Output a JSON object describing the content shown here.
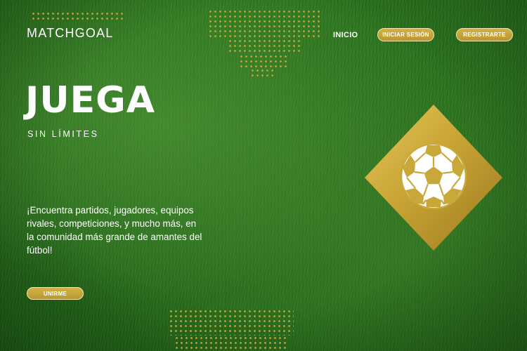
{
  "header": {
    "logo": "MATCHGOAL",
    "nav_home": "INICIO",
    "login_label": "INICIAR SESIÓN",
    "register_label": "REGISTRARTE"
  },
  "hero": {
    "title": "JUEGA",
    "subtitle": "SIN LÍMITES",
    "description": "¡Encuentra partidos, jugadores, equipos rivales, competiciones, y mucho más, en la comunidad más grande de amantes del fútbol!",
    "join_label": "UNIRME"
  },
  "icons": {
    "ball": "soccer-ball-icon"
  },
  "colors": {
    "accent_gold": "#c9a83a",
    "pill_border": "#f3e6b0",
    "grass": "#2b7020",
    "text": "#ffffff"
  }
}
